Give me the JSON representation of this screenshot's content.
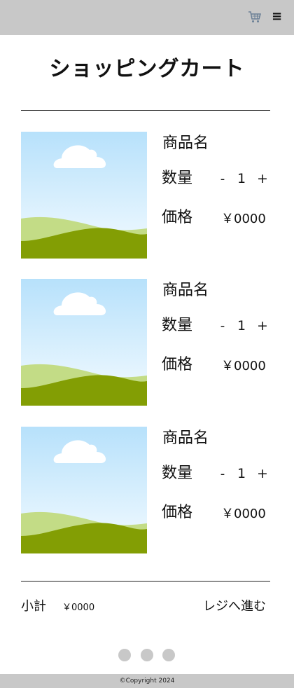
{
  "header": {
    "cart_icon": "cart-icon",
    "menu_icon": "hamburger-menu-icon",
    "menu_glyph": "≡"
  },
  "page": {
    "title": "ショッピングカート"
  },
  "items": [
    {
      "name": "商品名",
      "quantity_label": "数量",
      "minus": "-",
      "quantity": "1",
      "plus": "+",
      "price_label": "価格",
      "price": "￥0000"
    },
    {
      "name": "商品名",
      "quantity_label": "数量",
      "minus": "-",
      "quantity": "1",
      "plus": "+",
      "price_label": "価格",
      "price": "￥0000"
    },
    {
      "name": "商品名",
      "quantity_label": "数量",
      "minus": "-",
      "quantity": "1",
      "plus": "+",
      "price_label": "価格",
      "price": "￥0000"
    }
  ],
  "summary": {
    "subtotal_label": "小計",
    "subtotal_value": "￥0000",
    "checkout_label": "レジへ進む"
  },
  "pagination": {
    "dots": 3
  },
  "footer": {
    "copyright": "©Copyright 2024"
  },
  "colors": {
    "bar": "#c8c8c8",
    "sky_top": "#b7e1fb",
    "sky_bottom": "#f4fbff",
    "hill_light": "#c3dc86",
    "hill_dark": "#839e04",
    "cloud": "#ffffff"
  }
}
